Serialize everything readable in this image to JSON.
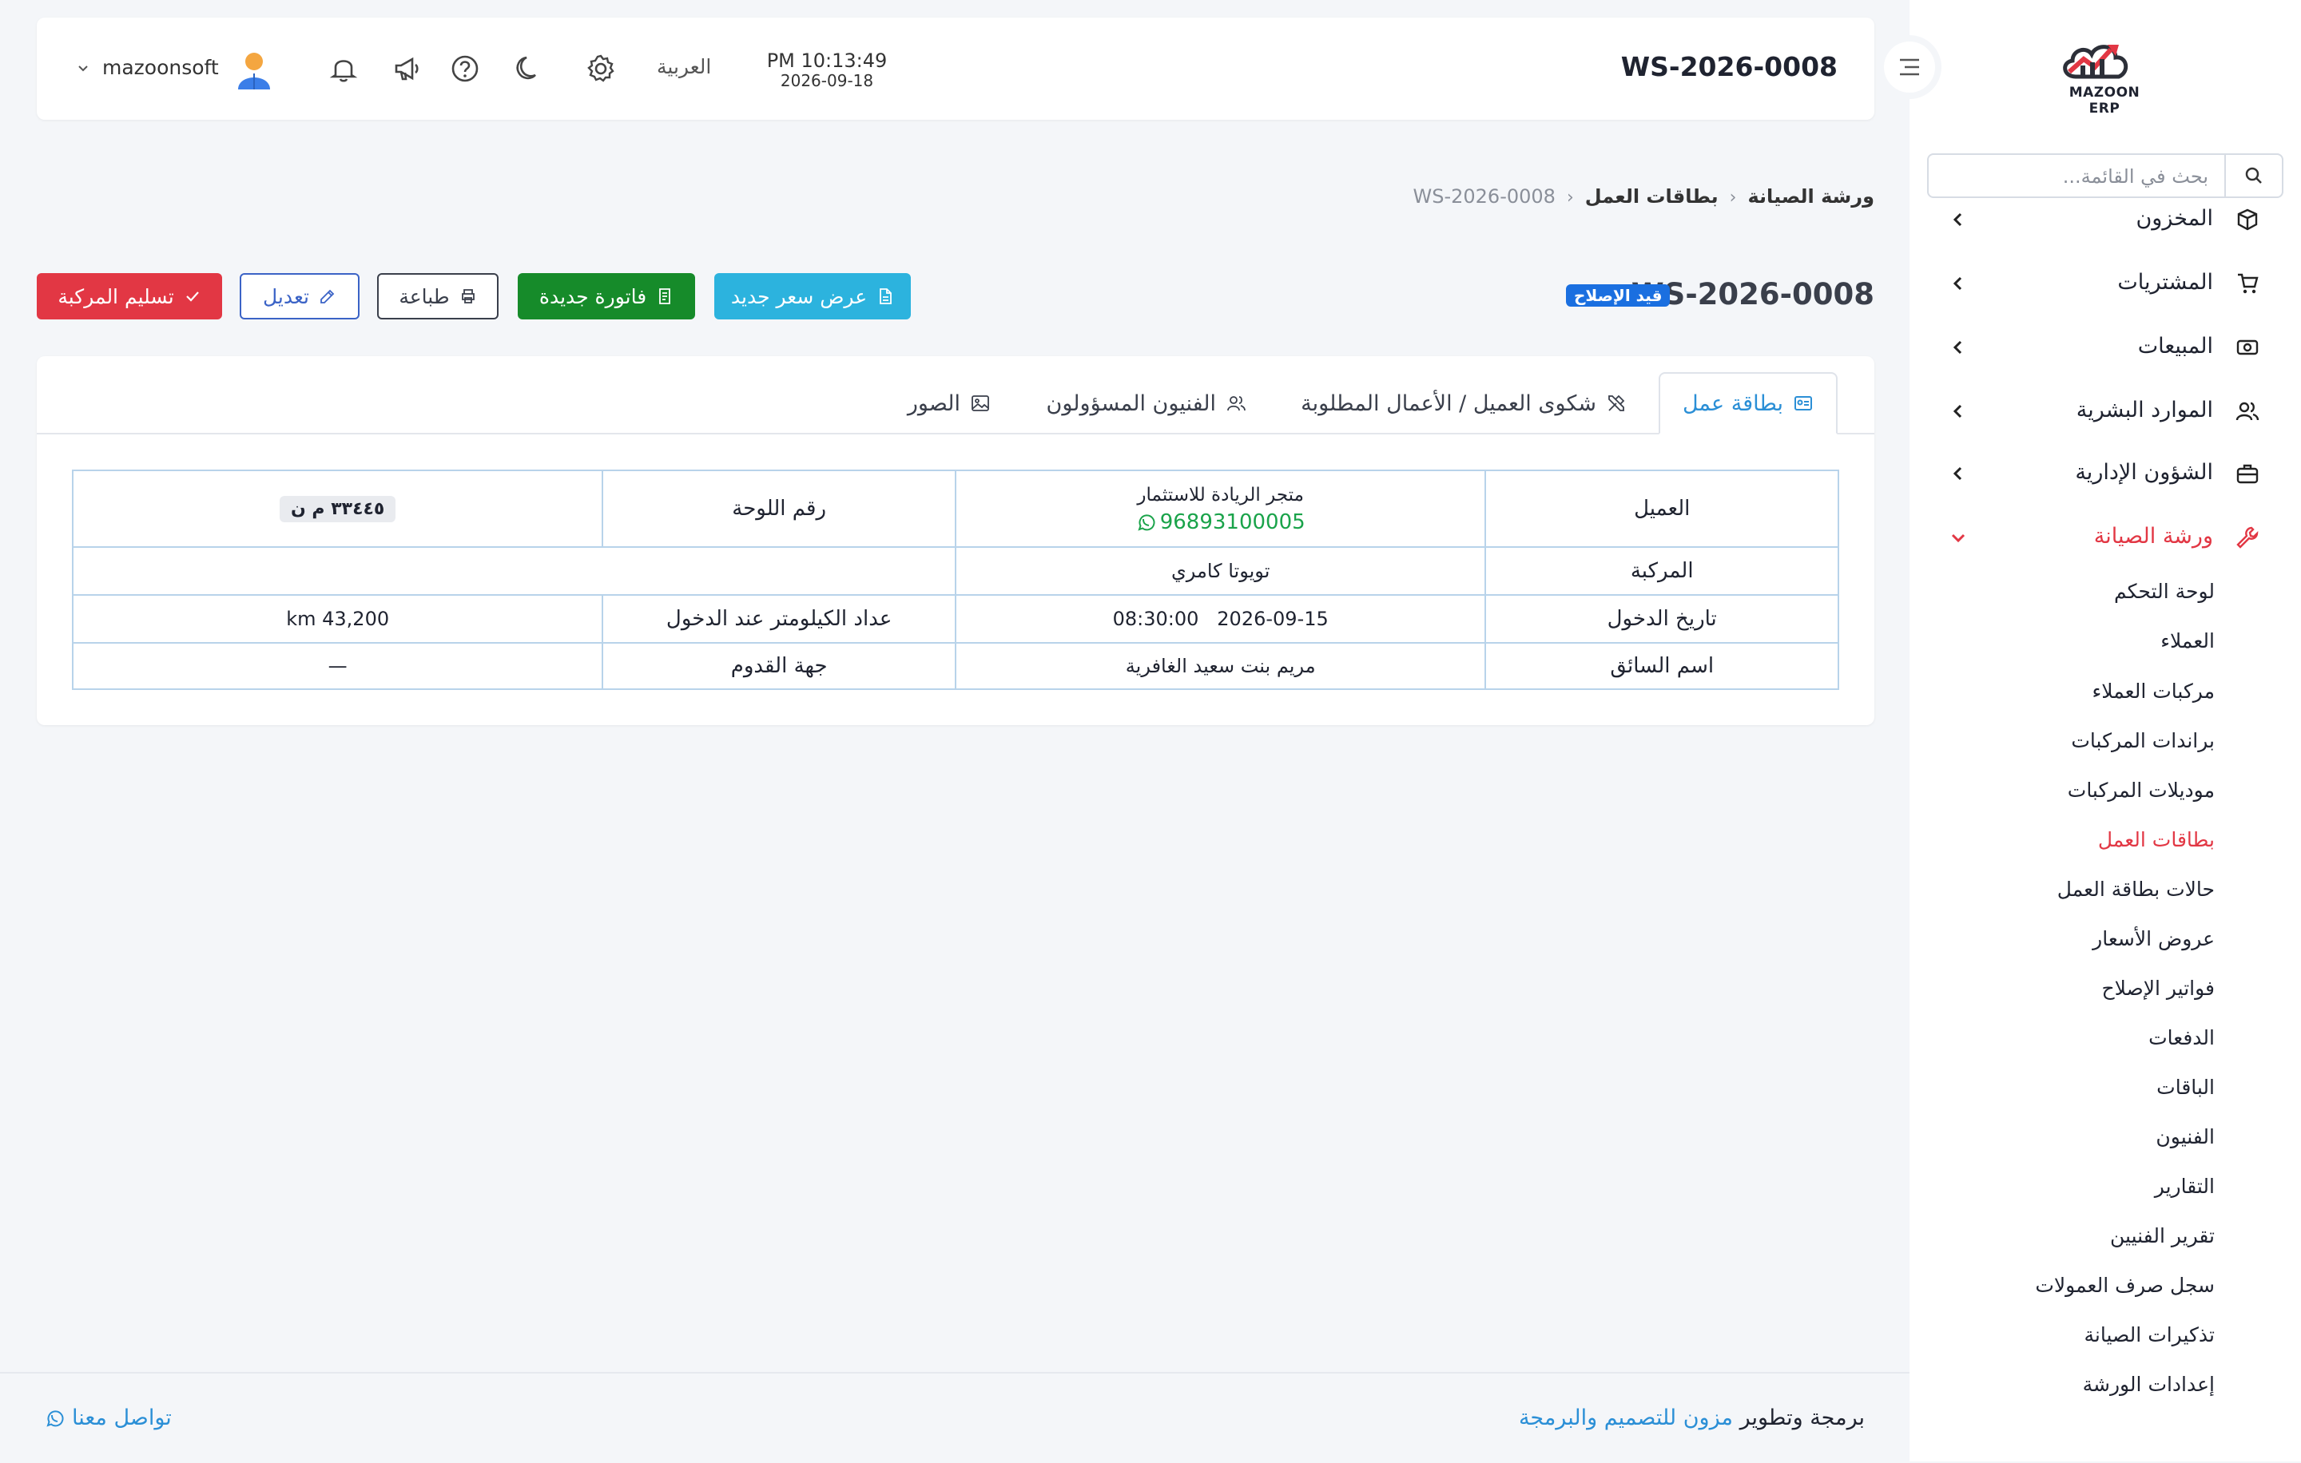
{
  "app": {
    "logo_text": "MAZOON ERP",
    "logo_small": "ERP"
  },
  "sidebar": {
    "search_placeholder": "بحث في القائمة...",
    "items": [
      {
        "label": "المخزون",
        "icon": "box-icon"
      },
      {
        "label": "المشتريات",
        "icon": "cart-icon"
      },
      {
        "label": "المبيعات",
        "icon": "cash-icon"
      },
      {
        "label": "الموارد البشرية",
        "icon": "users-icon"
      },
      {
        "label": "الشؤون الإدارية",
        "icon": "briefcase-icon"
      },
      {
        "label": "ورشة الصيانة",
        "icon": "wrench-icon",
        "expanded": true
      }
    ],
    "workshop_sub": [
      "لوحة التحكم",
      "العملاء",
      "مركبات العملاء",
      "براندات المركبات",
      "موديلات المركبات",
      "بطاقات العمل",
      "حالات بطاقة العمل",
      "عروض الأسعار",
      "فواتير الإصلاح",
      "الدفعات",
      "الباقات",
      "الفنيون",
      "التقارير",
      "تقرير الفنيين",
      "سجل صرف العمولات",
      "تذكيرات الصيانة",
      "إعدادات الورشة"
    ],
    "active_sub": "بطاقات العمل"
  },
  "header": {
    "title": "WS-2026-0008",
    "time": "PM 10:13:49",
    "date": "2026-09-18",
    "language": "العربية",
    "username": "mazoonsoft"
  },
  "breadcrumb": {
    "root": "ورشة الصيانة",
    "section": "بطاقات العمل",
    "current": "WS-2026-0008"
  },
  "page": {
    "title": "WS-2026-0008",
    "status": "قيد الإصلاح"
  },
  "actions": {
    "new_quote": "عرض سعر جديد",
    "new_invoice": "فاتورة جديدة",
    "print": "طباعة",
    "edit": "تعديل",
    "deliver": "تسليم المركبة"
  },
  "tabs": {
    "job_card": "بطاقة عمل",
    "complaints": "شكوى العميل / الأعمال المطلوبة",
    "technicians": "الفنيون المسؤولون",
    "photos": "الصور"
  },
  "job": {
    "customer_label": "العميل",
    "customer_name": "متجر الريادة للاستثمار",
    "customer_phone": "96893100005",
    "plate_label": "رقم اللوحة",
    "plate_value": "٣٣٤٤٥ م ن",
    "vehicle_label": "المركبة",
    "vehicle_value": "تويوتا كامري",
    "entry_date_label": "تاريخ الدخول",
    "entry_date": "2026-09-15",
    "entry_time": "08:30:00",
    "odometer_label": "عداد الكيلومتر عند الدخول",
    "odometer_value": "km 43,200",
    "driver_label": "اسم السائق",
    "driver_value": "مريم بنت سعيد الغافرية",
    "origin_label": "جهة القدوم",
    "origin_value": "—"
  },
  "footer": {
    "credit_prefix": "برمجة وتطوير",
    "credit_company": "مزون للتصميم والبرمجة",
    "contact": "تواصل معنا"
  },
  "colors": {
    "accent_red": "#e23744",
    "accent_blue": "#2b8fd6",
    "badge_blue": "#1a6fe0",
    "success_green": "#168b2a",
    "quote_cyan": "#2cb3de",
    "phone_green": "#1aa34a"
  }
}
